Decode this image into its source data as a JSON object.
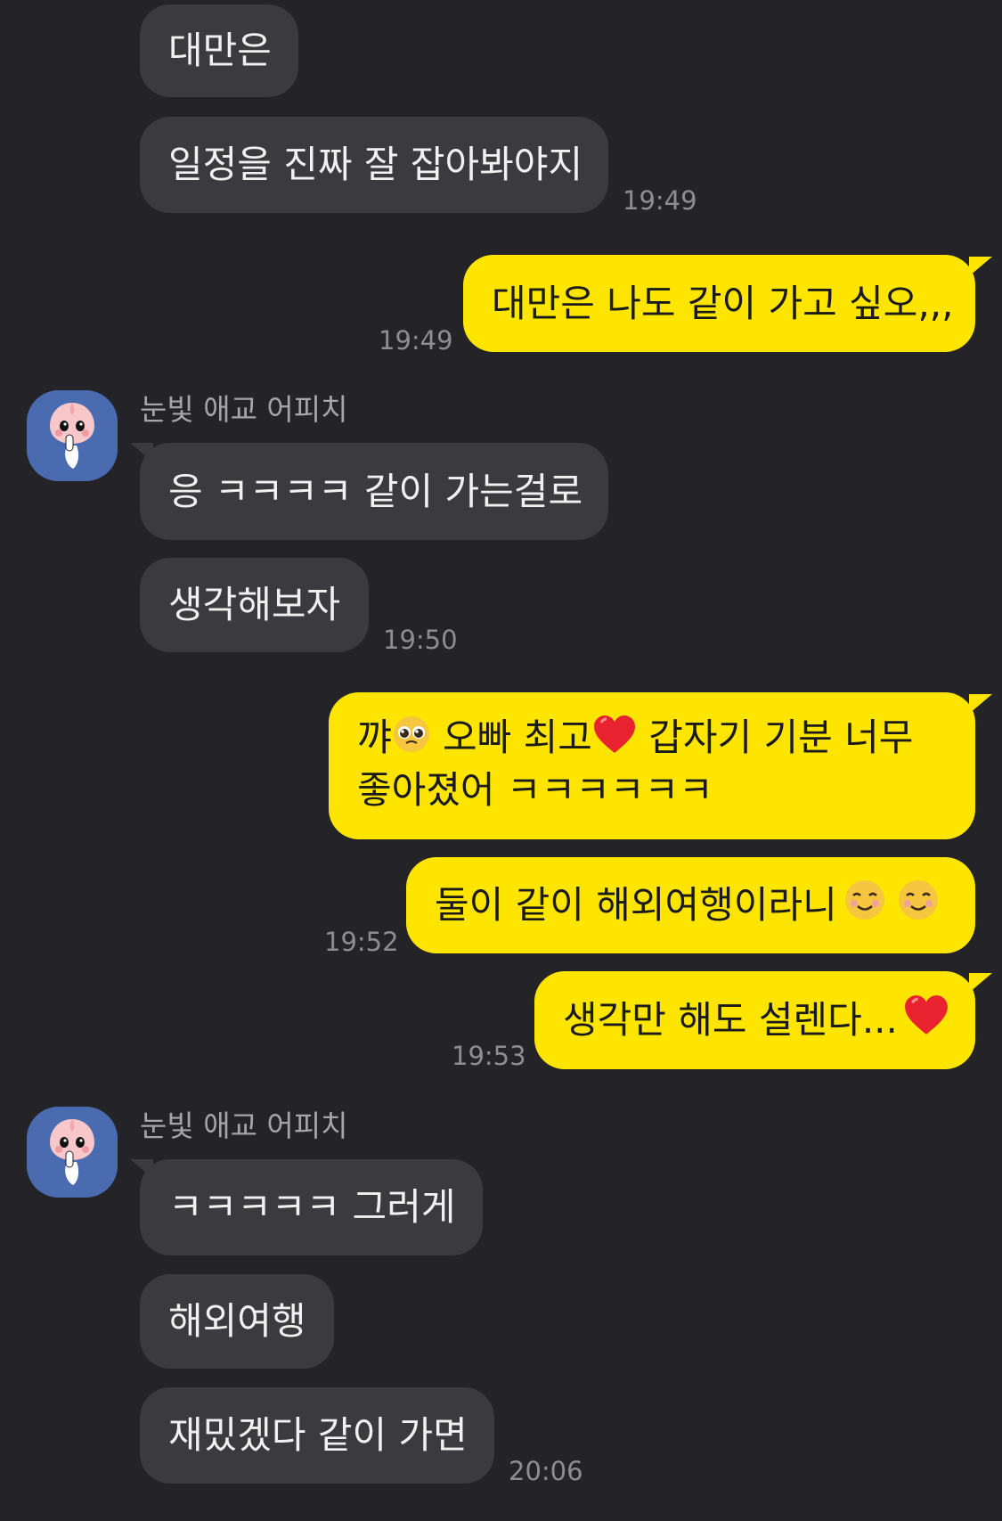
{
  "colors": {
    "background": "#242428",
    "incoming_bubble": "#3a3a3f",
    "outgoing_bubble": "#fee500",
    "timestamp": "#8d8d92",
    "sender_name": "#a5a5aa",
    "avatar_bg": "#4a6bb0"
  },
  "messages": {
    "m1": {
      "text": "대만은"
    },
    "m2": {
      "text": "일정을 진짜 잘 잡아봐야지",
      "time": "19:49"
    },
    "m3": {
      "text": "대만은 나도 같이 가고 싶오,,,",
      "time": "19:49"
    },
    "sender1": {
      "name": "눈빛 애교 어피치",
      "avatar_icon": "apeach-avatar-icon"
    },
    "m4": {
      "text": "응 ㅋㅋㅋㅋ 같이 가는걸로"
    },
    "m5": {
      "text": "생각해보자",
      "time": "19:50"
    },
    "m6": {
      "line1_a": "꺄",
      "line1_b": " 오빠 최고",
      "line1_c": " 갑자기 기분 너무",
      "line2": "좋아졌어 ㅋㅋㅋㅋㅋㅋ",
      "emoji1": "pleading-face-icon",
      "emoji2": "red-heart-icon"
    },
    "m7": {
      "text": "둘이 같이 해외여행이라니",
      "time": "19:52",
      "emoji": "smiling-face-icon"
    },
    "m8": {
      "text": "생각만 해도 설렌다...",
      "time": "19:53",
      "emoji": "red-heart-icon"
    },
    "sender2": {
      "name": "눈빛 애교 어피치",
      "avatar_icon": "apeach-avatar-icon"
    },
    "m9": {
      "text": "ㅋㅋㅋㅋㅋ 그러게"
    },
    "m10": {
      "text": "해외여행"
    },
    "m11": {
      "text": "재밌겠다 같이 가면",
      "time": "20:06"
    }
  }
}
